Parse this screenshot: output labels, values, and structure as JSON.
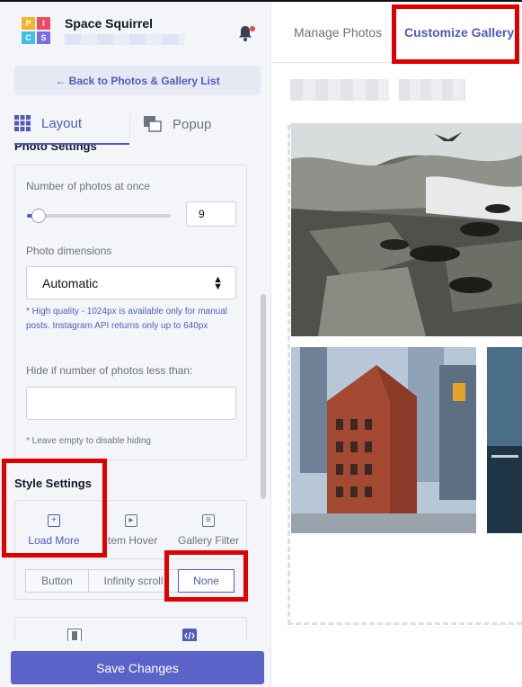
{
  "app": {
    "brand_name": "Space Squirrel",
    "logo_letters": [
      "P",
      "I",
      "C",
      "S"
    ],
    "logo_colors": [
      "#f7b32b",
      "#ef4b5f",
      "#3dbfe8",
      "#7b6be8"
    ]
  },
  "sidebar": {
    "back_label": "← Back to Photos & Gallery List",
    "tabs": [
      {
        "label": "Layout",
        "icon": "grid-icon",
        "active": true
      },
      {
        "label": "Popup",
        "icon": "popup-icon",
        "active": false
      }
    ],
    "photo_settings": {
      "title": "Photo Settings",
      "count_label": "Number of photos at once",
      "count_value": "9",
      "count_fraction": 0.03,
      "dimensions_label": "Photo dimensions",
      "dimensions_value": "Automatic",
      "quality_note": "* High quality - 1024px is available only for manual posts. Instagram API returns only up to 640px",
      "hide_label": "Hide if number of photos less than:",
      "hide_value": "",
      "hide_note": "* Leave empty to disable hiding"
    },
    "style_settings": {
      "title": "Style Settings",
      "tabs": [
        {
          "label": "Load More",
          "icon": "plus-square-icon",
          "active": true
        },
        {
          "label": "Item Hover",
          "icon": "cursor-icon",
          "active": false
        },
        {
          "label": "Gallery Filter",
          "icon": "sliders-icon",
          "active": false
        }
      ],
      "load_more_options": [
        {
          "label": "Button",
          "active": false
        },
        {
          "label": "Infinity scroll",
          "active": false
        },
        {
          "label": "None",
          "active": true
        }
      ]
    },
    "save_label": "Save Changes"
  },
  "main": {
    "tabs": [
      {
        "label": "Manage Photos",
        "active": false
      },
      {
        "label": "Customize Gallery",
        "active": true
      }
    ]
  },
  "colors": {
    "accent": "#4f5bbd",
    "save_button": "#5b63c9",
    "highlight": "#e00000",
    "sidebar_bg": "#f4f5f9"
  }
}
